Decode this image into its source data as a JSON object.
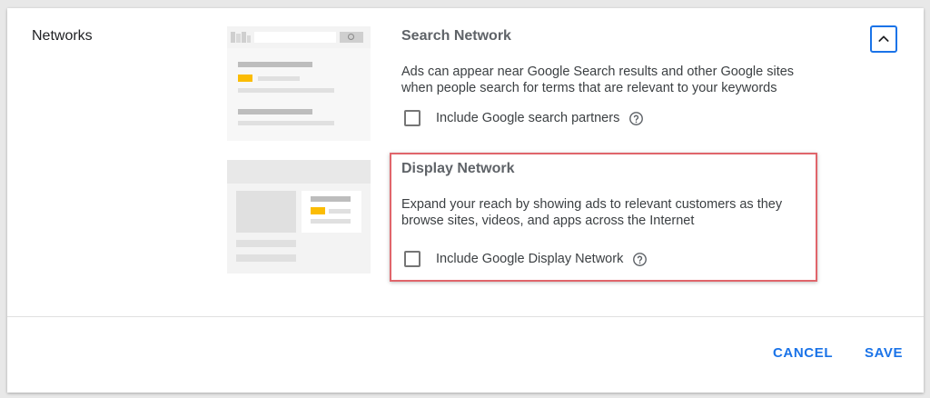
{
  "section": {
    "title": "Networks"
  },
  "search_network": {
    "title": "Search Network",
    "description_line1": "Ads can appear near Google Search results and other Google sites",
    "description_line2": "when people search for terms that are relevant to your keywords",
    "checkbox_label": "Include Google search partners",
    "checked": false
  },
  "display_network": {
    "title": "Display Network",
    "description_line1": "Expand your reach by showing ads to relevant customers as they",
    "description_line2": "browse sites, videos, and apps across the Internet",
    "checkbox_label": "Include Google Display Network",
    "checked": false
  },
  "actions": {
    "cancel": "CANCEL",
    "save": "SAVE"
  },
  "icons": {
    "collapse": "chevron-up-icon",
    "help": "help-circle-icon"
  },
  "colors": {
    "accent": "#1a73e8",
    "highlight": "#e0656b",
    "illustration_accent": "#fbbc04"
  }
}
